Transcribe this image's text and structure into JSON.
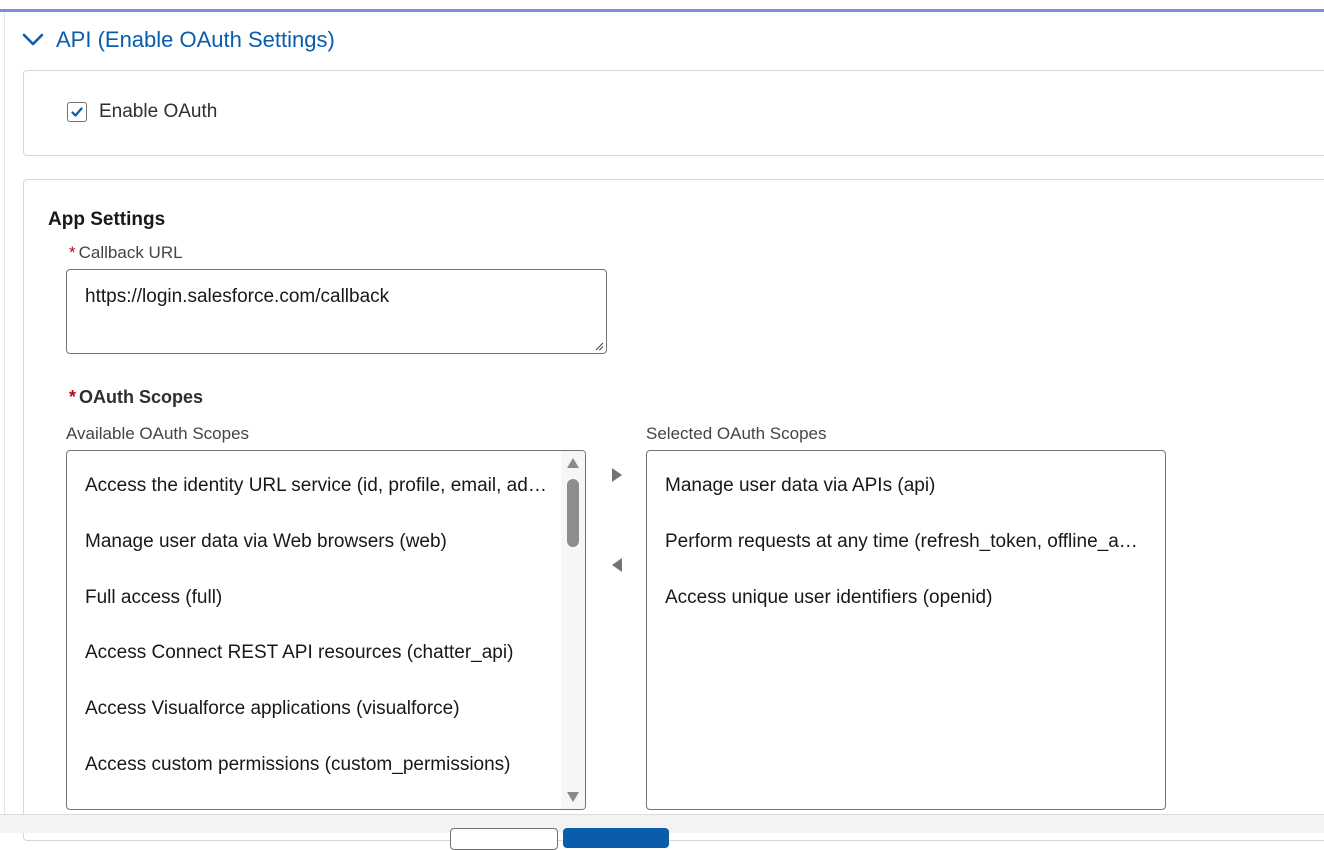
{
  "section": {
    "title": "API (Enable OAuth Settings)"
  },
  "enable_oauth": {
    "label": "Enable OAuth",
    "checked": true
  },
  "app_settings": {
    "title": "App Settings",
    "callback_url": {
      "required_mark": "*",
      "label": "Callback URL",
      "value": "https://login.salesforce.com/callback"
    },
    "oauth_scopes": {
      "required_mark": "*",
      "label": "OAuth Scopes",
      "available_label": "Available OAuth Scopes",
      "selected_label": "Selected OAuth Scopes",
      "available": [
        "Access the identity URL service (id, profile, email, address, phone)",
        "Manage user data via Web browsers (web)",
        "Full access (full)",
        "Access Connect REST API resources (chatter_api)",
        "Access Visualforce applications (visualforce)",
        "Access custom permissions (custom_permissions)"
      ],
      "selected": [
        "Manage user data via APIs (api)",
        "Perform requests at any time (refresh_token, offline_access)",
        "Access unique user identifiers (openid)"
      ]
    }
  },
  "colors": {
    "accent": "#0b5cab",
    "required": "#ba0517",
    "header_line": "#7f8de1"
  },
  "icons": {
    "section_toggle": "chevron-down-icon",
    "checkbox_check": "check-icon",
    "move_right": "right-arrow-icon",
    "move_left": "left-arrow-icon",
    "scroll_up": "scroll-up-icon",
    "scroll_down": "scroll-down-icon"
  }
}
